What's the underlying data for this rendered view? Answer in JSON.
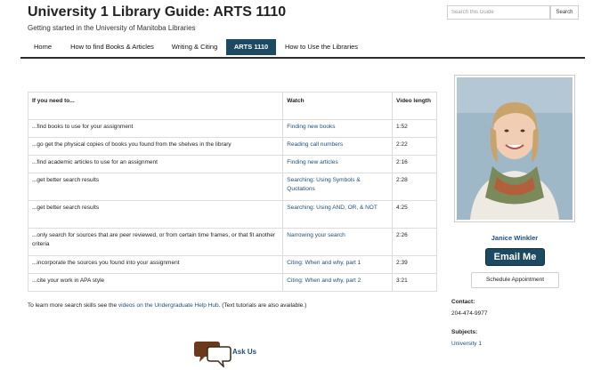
{
  "header": {
    "title": "University 1 Library Guide: ARTS 1110",
    "subtitle": "Getting started in the University of Manitoba Libraries",
    "search_placeholder": "Search this Guide",
    "search_button": "Search"
  },
  "nav": {
    "tabs": [
      {
        "label": "Home",
        "active": false
      },
      {
        "label": "How to find Books & Articles",
        "active": false
      },
      {
        "label": "Writing & Citing",
        "active": false
      },
      {
        "label": "ARTS 1110",
        "active": true
      },
      {
        "label": "How to Use the Libraries",
        "active": false
      }
    ]
  },
  "table": {
    "headers": [
      "If you need to...",
      "Watch",
      "Video length"
    ],
    "rows": [
      {
        "need": "...find books to use for your assignment",
        "watch": "Finding new books",
        "length": "1:52"
      },
      {
        "need": "...go get the physical copies of books you found from the shelves in the library",
        "watch": "Reading call numbers",
        "length": "2:22"
      },
      {
        "need": "...find academic articles to use for an assignment",
        "watch": "Finding new articles",
        "length": "2:16"
      },
      {
        "need": "...get better search results",
        "watch": "Searching: Using Symbols & Quotations",
        "length": "2:28"
      },
      {
        "need": "...get better search results",
        "watch": "Searching: Using AND, OR, & NOT",
        "length": "4:25"
      },
      {
        "need": "...only search for sources that are peer reviewed, or from certain time frames, or that fit another criteria",
        "watch": "Narrowing your search",
        "length": "2:26"
      },
      {
        "need": "...incorporate the sources you found into your assignment",
        "watch": "Citing: When and why, part 1",
        "length": "2:39"
      },
      {
        "need": "...cite your work in APA style",
        "watch": "Citing: When and why, part 2",
        "length": "3:21"
      }
    ]
  },
  "more": {
    "before": "To learn more search skills see the ",
    "link": "videos on the Undergraduate Help Hub",
    "after": ". (Text tutorials are also available.)"
  },
  "askus": {
    "label": "Ask Us",
    "icon": "speech-bubbles-icon"
  },
  "profile": {
    "name": "Janice Winkler",
    "email_button": "Email Me",
    "schedule_button": "Schedule Appointment",
    "contact_label": "Contact:",
    "phone": "204-474-9977",
    "subjects_label": "Subjects:",
    "subject": "University 1"
  },
  "colors": {
    "accent": "#1d4a63",
    "link": "#1f4e79"
  }
}
